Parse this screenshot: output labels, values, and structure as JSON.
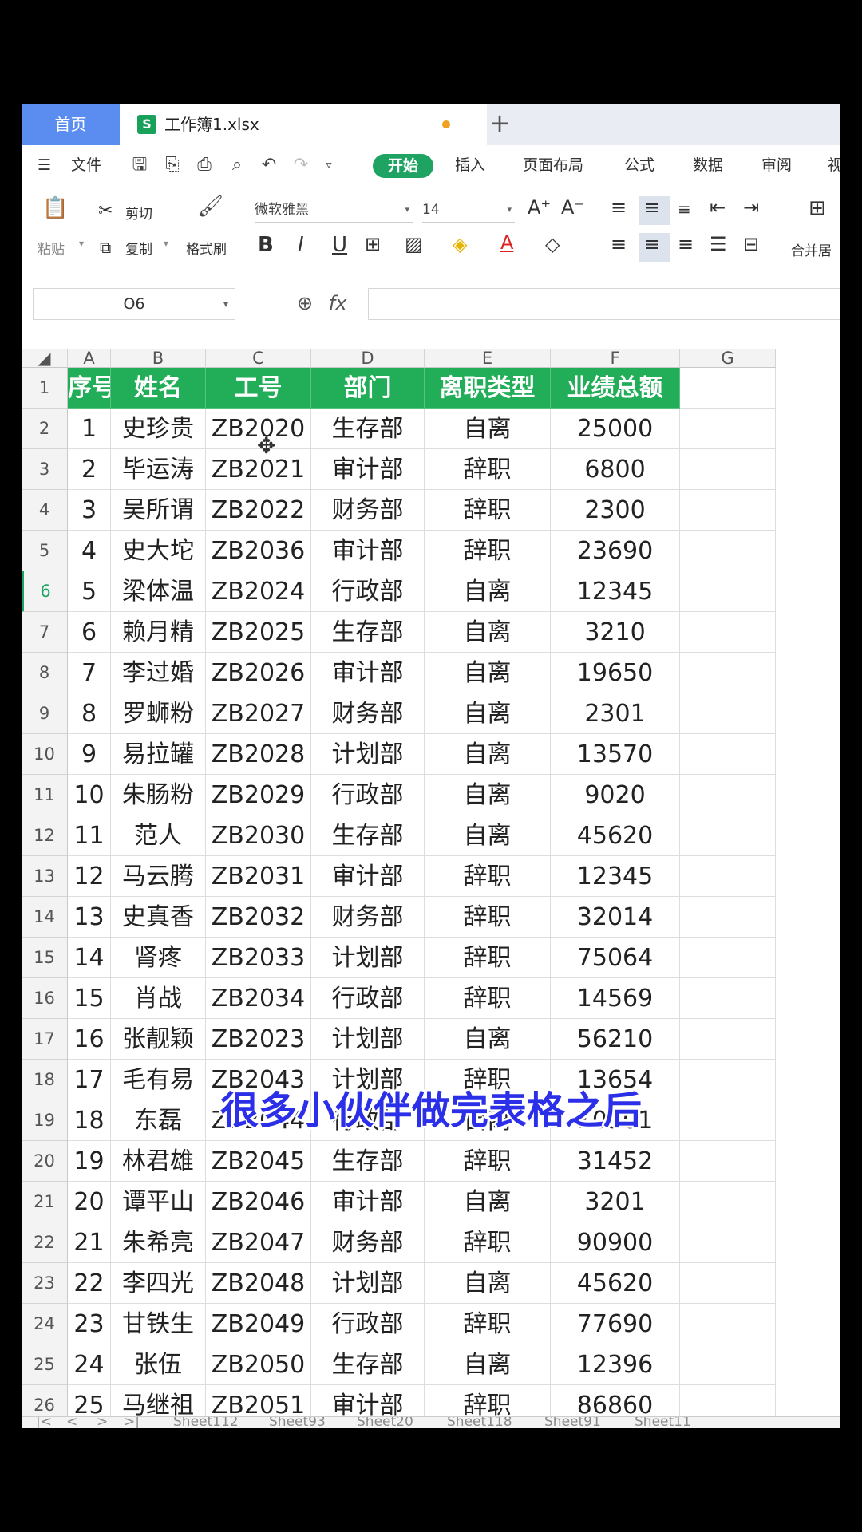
{
  "tabs": {
    "home": "首页",
    "file": "工作簿1.xlsx",
    "file_icon": "S",
    "new_tab": "+"
  },
  "menu": {
    "file": "文件",
    "items": [
      "开始",
      "插入",
      "页面布局",
      "公式",
      "数据",
      "审阅",
      "视"
    ]
  },
  "ribbon": {
    "paste": "粘贴",
    "cut": "剪切",
    "copy": "复制",
    "format_painter": "格式刷",
    "font_name": "微软雅黑",
    "font_size": "14",
    "merge": "合并居",
    "bold": "B",
    "italic": "I",
    "underline": "U"
  },
  "formula_bar": {
    "cell_ref": "O6",
    "fx": "fx"
  },
  "columns": [
    "A",
    "B",
    "C",
    "D",
    "E",
    "F",
    "G"
  ],
  "header_row": [
    "序号",
    "姓名",
    "工号",
    "部门",
    "离职类型",
    "业绩总额"
  ],
  "rows": [
    [
      "1",
      "史珍贵",
      "ZB2020",
      "生存部",
      "自离",
      "25000"
    ],
    [
      "2",
      "毕运涛",
      "ZB2021",
      "审计部",
      "辞职",
      "6800"
    ],
    [
      "3",
      "吴所谓",
      "ZB2022",
      "财务部",
      "辞职",
      "2300"
    ],
    [
      "4",
      "史大坨",
      "ZB2036",
      "审计部",
      "辞职",
      "23690"
    ],
    [
      "5",
      "梁体温",
      "ZB2024",
      "行政部",
      "自离",
      "12345"
    ],
    [
      "6",
      "赖月精",
      "ZB2025",
      "生存部",
      "自离",
      "3210"
    ],
    [
      "7",
      "李过婚",
      "ZB2026",
      "审计部",
      "自离",
      "19650"
    ],
    [
      "8",
      "罗蛳粉",
      "ZB2027",
      "财务部",
      "自离",
      "2301"
    ],
    [
      "9",
      "易拉罐",
      "ZB2028",
      "计划部",
      "自离",
      "13570"
    ],
    [
      "10",
      "朱肠粉",
      "ZB2029",
      "行政部",
      "自离",
      "9020"
    ],
    [
      "11",
      "范人",
      "ZB2030",
      "生存部",
      "自离",
      "45620"
    ],
    [
      "12",
      "马云腾",
      "ZB2031",
      "审计部",
      "辞职",
      "12345"
    ],
    [
      "13",
      "史真香",
      "ZB2032",
      "财务部",
      "辞职",
      "32014"
    ],
    [
      "14",
      "肾疼",
      "ZB2033",
      "计划部",
      "辞职",
      "75064"
    ],
    [
      "15",
      "肖战",
      "ZB2034",
      "行政部",
      "辞职",
      "14569"
    ],
    [
      "16",
      "张靓颖",
      "ZB2023",
      "计划部",
      "自离",
      "56210"
    ],
    [
      "17",
      "毛有易",
      "ZB2043",
      "计划部",
      "辞职",
      "13654"
    ],
    [
      "18",
      "东磊",
      "ZB2044",
      "行政部",
      "自离",
      "10501"
    ],
    [
      "19",
      "林君雄",
      "ZB2045",
      "生存部",
      "辞职",
      "31452"
    ],
    [
      "20",
      "谭平山",
      "ZB2046",
      "审计部",
      "自离",
      "3201"
    ],
    [
      "21",
      "朱希亮",
      "ZB2047",
      "财务部",
      "辞职",
      "90900"
    ],
    [
      "22",
      "李四光",
      "ZB2048",
      "计划部",
      "自离",
      "45620"
    ],
    [
      "23",
      "甘铁生",
      "ZB2049",
      "行政部",
      "辞职",
      "77690"
    ],
    [
      "24",
      "张伍",
      "ZB2050",
      "生存部",
      "自离",
      "12396"
    ],
    [
      "25",
      "马继祖",
      "ZB2051",
      "审计部",
      "辞职",
      "86860"
    ]
  ],
  "row_numbers": [
    "1",
    "2",
    "3",
    "4",
    "5",
    "6",
    "7",
    "8",
    "9",
    "10",
    "11",
    "12",
    "13",
    "14",
    "15",
    "16",
    "17",
    "18",
    "19",
    "20",
    "21",
    "22",
    "23",
    "24",
    "25",
    "26"
  ],
  "selected_row": "6",
  "sheets": [
    "Sheet112",
    "Sheet93",
    "Sheet20",
    "Sheet118",
    "Sheet91",
    "Sheet11"
  ],
  "caption": "很多小伙伴做完表格之后",
  "colors": {
    "header_green": "#22ad58",
    "home_tab_blue": "#5b8cf0",
    "caption_blue": "#2c2fe8"
  }
}
